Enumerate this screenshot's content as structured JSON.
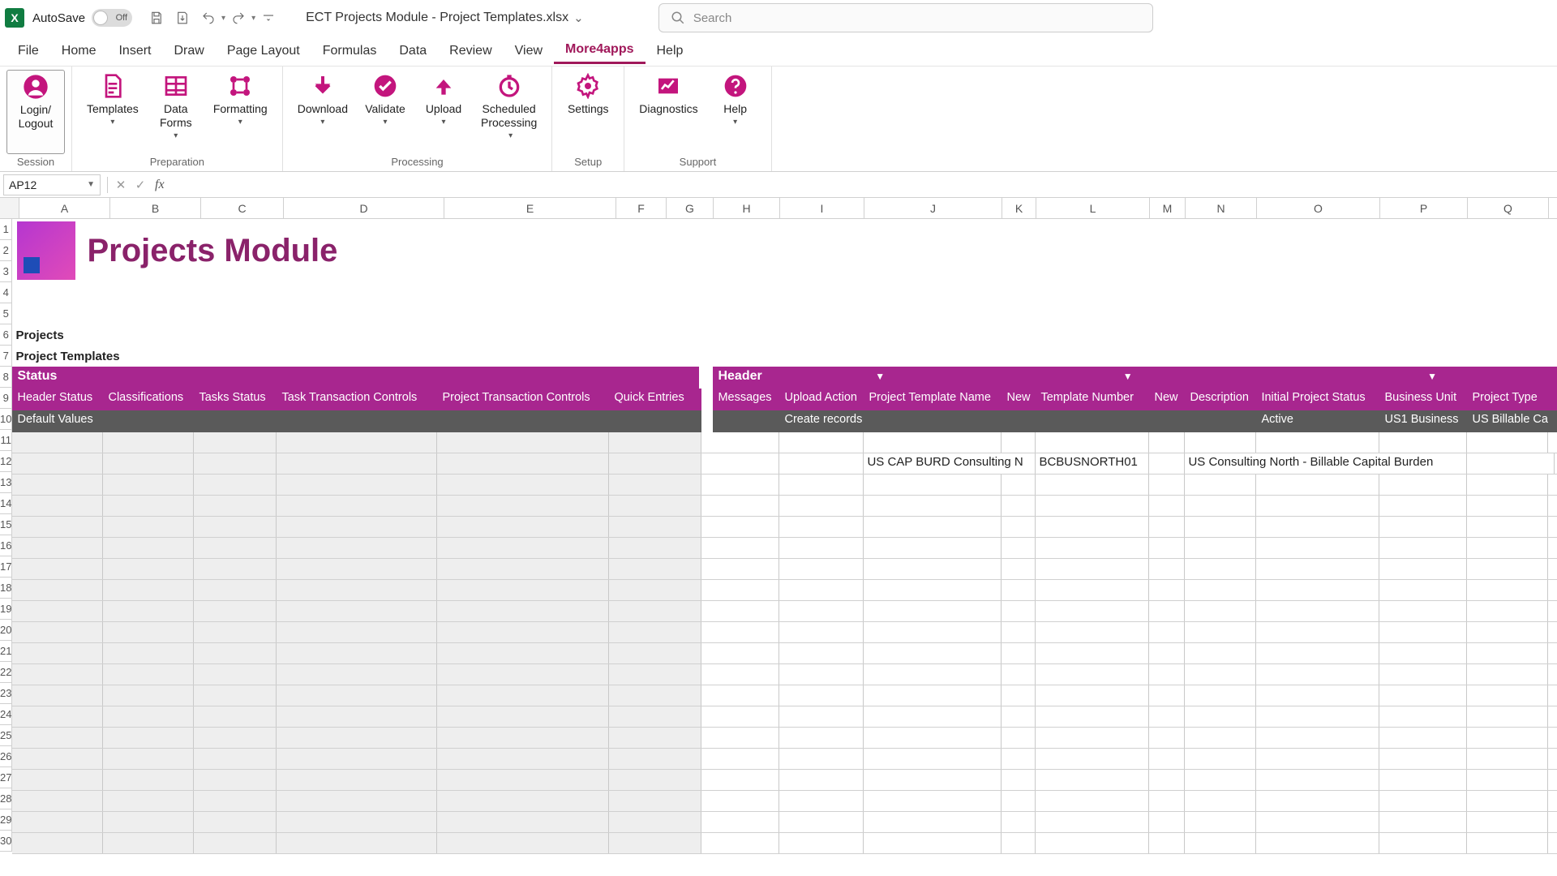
{
  "titlebar": {
    "autosave_label": "AutoSave",
    "autosave_state": "Off",
    "doc_title": "ECT Projects Module - Project Templates.xlsx",
    "search_placeholder": "Search"
  },
  "menu": {
    "tabs": [
      "File",
      "Home",
      "Insert",
      "Draw",
      "Page Layout",
      "Formulas",
      "Data",
      "Review",
      "View",
      "More4apps",
      "Help"
    ],
    "active": "More4apps"
  },
  "ribbon": {
    "groups": [
      {
        "label": "Session",
        "items": [
          {
            "name": "login",
            "label": "Login/\nLogout",
            "icon": "user",
            "caret": false,
            "selected": true
          }
        ]
      },
      {
        "label": "Preparation",
        "items": [
          {
            "name": "templates",
            "label": "Templates",
            "icon": "file",
            "caret": true
          },
          {
            "name": "dataforms",
            "label": "Data\nForms",
            "icon": "table",
            "caret": true
          },
          {
            "name": "formatting",
            "label": "Formatting",
            "icon": "nodes",
            "caret": true
          }
        ]
      },
      {
        "label": "Processing",
        "items": [
          {
            "name": "download",
            "label": "Download",
            "icon": "down",
            "caret": true
          },
          {
            "name": "validate",
            "label": "Validate",
            "icon": "check",
            "caret": true
          },
          {
            "name": "upload",
            "label": "Upload",
            "icon": "up",
            "caret": true
          },
          {
            "name": "scheduled",
            "label": "Scheduled\nProcessing",
            "icon": "clock",
            "caret": true
          }
        ]
      },
      {
        "label": "Setup",
        "items": [
          {
            "name": "settings",
            "label": "Settings",
            "icon": "gear",
            "caret": false
          }
        ]
      },
      {
        "label": "Support",
        "items": [
          {
            "name": "diagnostics",
            "label": "Diagnostics",
            "icon": "chart",
            "caret": false
          },
          {
            "name": "help",
            "label": "Help",
            "icon": "help",
            "caret": true
          }
        ]
      }
    ]
  },
  "formula_bar": {
    "cell_ref": "AP12",
    "formula": ""
  },
  "columns": [
    "A",
    "B",
    "C",
    "D",
    "E",
    "F",
    "G",
    "H",
    "I",
    "J",
    "K",
    "L",
    "M",
    "N",
    "O",
    "P",
    "Q"
  ],
  "rows": [
    "1",
    "2",
    "3",
    "4",
    "5",
    "6",
    "7",
    "8",
    "9",
    "10",
    "11",
    "12",
    "13",
    "14",
    "15",
    "16",
    "17",
    "18",
    "19",
    "20",
    "21",
    "22",
    "23",
    "24",
    "25",
    "26",
    "27",
    "28",
    "29",
    "30"
  ],
  "module_title": "Projects Module",
  "section_a": "Projects",
  "section_b": "Project Templates",
  "band": {
    "status": "Status",
    "header": "Header"
  },
  "subheaders": {
    "status": [
      "Header Status",
      "Classifications",
      "Tasks Status",
      "Task Transaction Controls",
      "Project Transaction Controls",
      "Quick Entries"
    ],
    "header": [
      "Messages",
      "Upload Action",
      "Project Template Name",
      "New",
      "Template Number",
      "New",
      "Description",
      "Initial Project Status",
      "Business Unit",
      "Project Type"
    ]
  },
  "defaults": {
    "label": "Default Values",
    "upload_action": "Create records",
    "initial_status": "Active",
    "business_unit": "US1 Business",
    "project_type": "US Billable Ca"
  },
  "data_row": {
    "template_name": "US CAP BURD Consulting N",
    "template_number": "BCBUSNORTH01",
    "description": "US Consulting North - Billable Capital Burden"
  }
}
